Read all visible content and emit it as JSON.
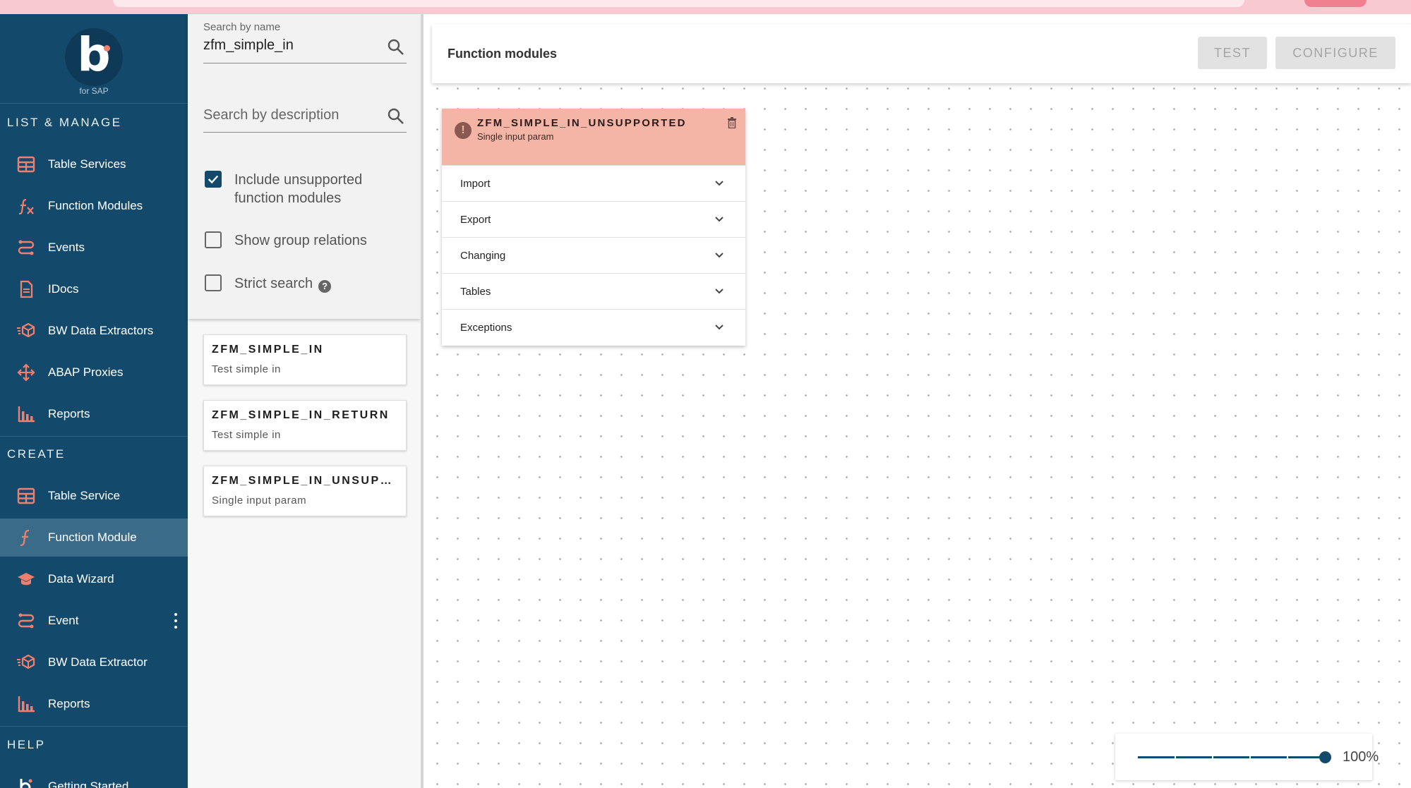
{
  "app": {
    "logo_sub": "for SAP"
  },
  "sidebar": {
    "list_manage_title": "LIST & MANAGE",
    "list_manage": [
      {
        "label": "Table Services",
        "icon": "table-icon"
      },
      {
        "label": "Function Modules",
        "icon": "function-icon"
      },
      {
        "label": "Events",
        "icon": "events-icon"
      },
      {
        "label": "IDocs",
        "icon": "document-icon"
      },
      {
        "label": "BW Data Extractors",
        "icon": "extractor-icon"
      },
      {
        "label": "ABAP Proxies",
        "icon": "proxy-icon"
      },
      {
        "label": "Reports",
        "icon": "bar-chart-icon"
      }
    ],
    "create_title": "CREATE",
    "create": [
      {
        "label": "Table Service",
        "icon": "table-icon"
      },
      {
        "label": "Function Module",
        "icon": "function-icon",
        "active": true
      },
      {
        "label": "Data Wizard",
        "icon": "wizard-icon"
      },
      {
        "label": "Event",
        "icon": "events-icon"
      },
      {
        "label": "BW Data Extractor",
        "icon": "extractor-icon"
      },
      {
        "label": "Reports",
        "icon": "bar-chart-icon"
      }
    ],
    "help_title": "HELP",
    "help": [
      {
        "label": "Getting Started",
        "icon": "logo-b-icon"
      }
    ],
    "accent_color": "#f07f6e",
    "bg_color": "#134a6b"
  },
  "search": {
    "name_label": "Search by name",
    "name_value": "zfm_simple_in",
    "desc_placeholder": "Search by description",
    "include_unsupported": {
      "label_line1": "Include unsupported",
      "label_line2": "function modules",
      "checked": true
    },
    "group_relations": {
      "label": "Show group relations",
      "checked": false
    },
    "strict": {
      "label": "Strict search",
      "checked": false
    }
  },
  "results": [
    {
      "title": "ZFM_SIMPLE_IN",
      "desc": "Test simple in"
    },
    {
      "title": "ZFM_SIMPLE_IN_RETURN",
      "desc": "Test simple in"
    },
    {
      "title": "ZFM_SIMPLE_IN_UNSUP…",
      "desc": "Single input param"
    }
  ],
  "header": {
    "title": "Function modules",
    "test_label": "TEST",
    "configure_label": "CONFIGURE"
  },
  "module_card": {
    "title": "ZFM_SIMPLE_IN_UNSUPPORTED",
    "subtitle": "Single input param",
    "header_color": "#f4b4a6",
    "sections": [
      "Import",
      "Export",
      "Changing",
      "Tables",
      "Exceptions"
    ]
  },
  "zoom": {
    "value_label": "100%",
    "value": 100
  }
}
